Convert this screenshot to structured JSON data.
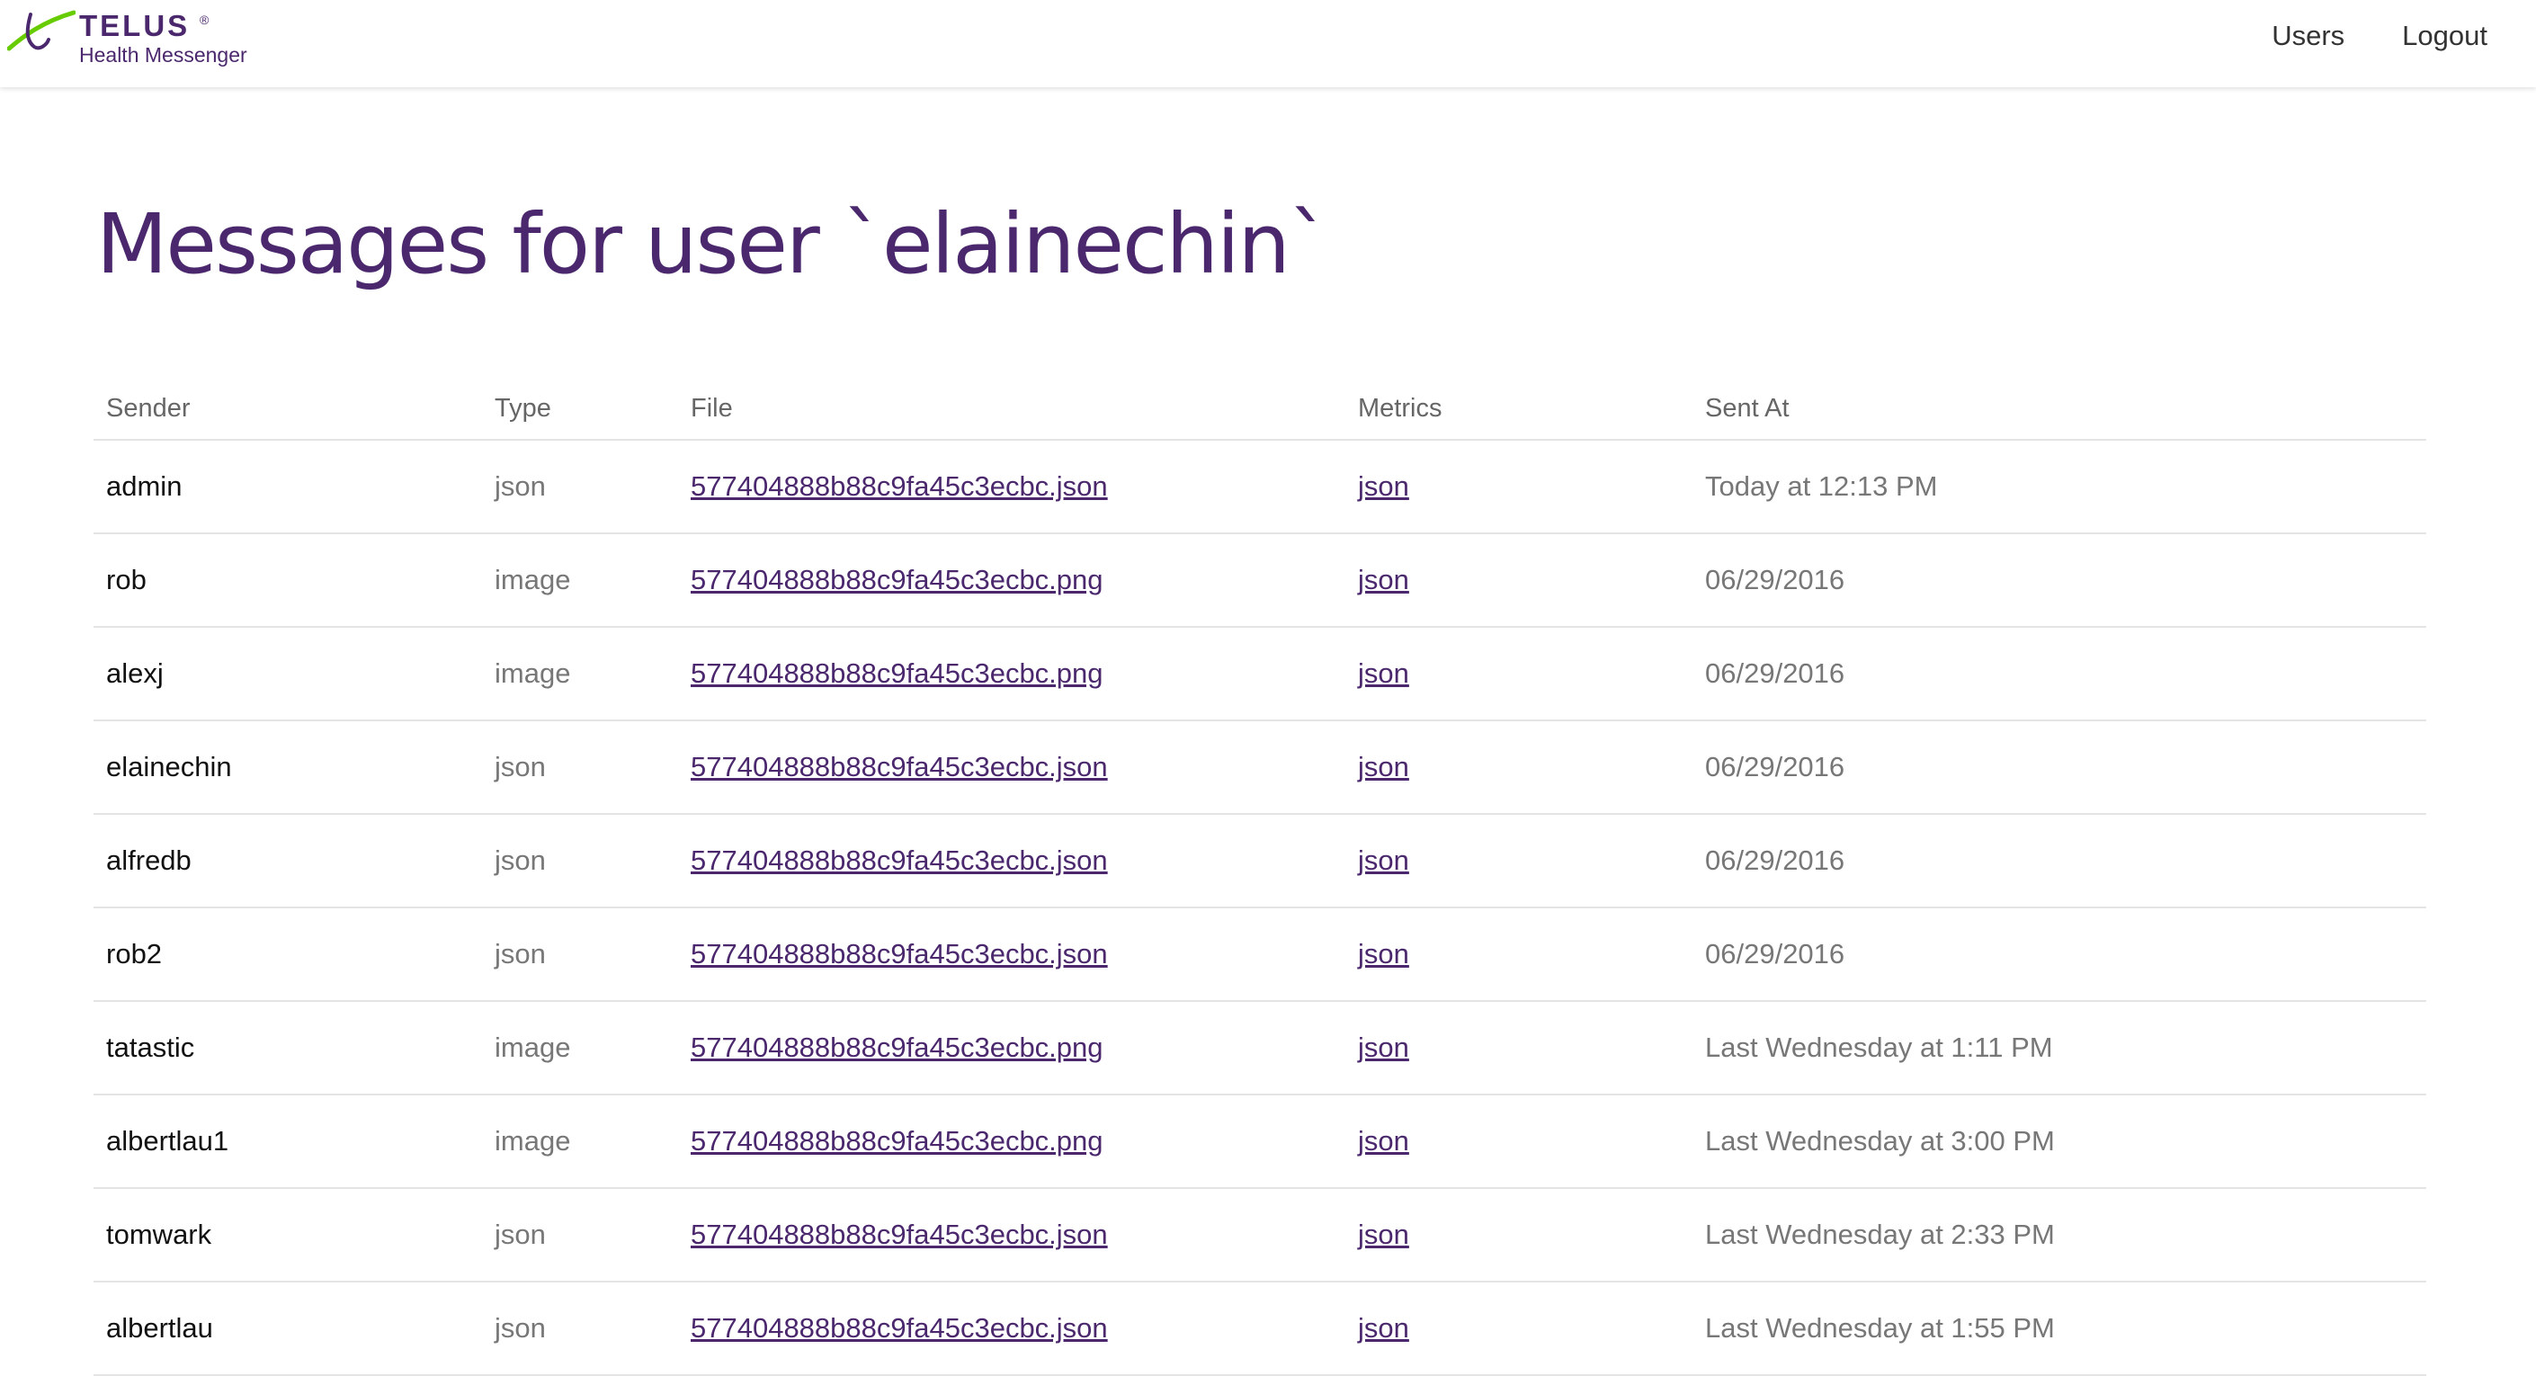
{
  "brand": {
    "name": "TELUS",
    "registered": "®",
    "product": "Health Messenger"
  },
  "nav": {
    "users_label": "Users",
    "logout_label": "Logout"
  },
  "page": {
    "title": "Messages for user `elainechin`"
  },
  "table": {
    "headers": {
      "sender": "Sender",
      "type": "Type",
      "file": "File",
      "metrics": "Metrics",
      "sent_at": "Sent At"
    },
    "rows": [
      {
        "sender": "admin",
        "type": "json",
        "file": "577404888b88c9fa45c3ecbc.json",
        "metrics": "json",
        "sent_at": "Today at 12:13 PM"
      },
      {
        "sender": "rob",
        "type": "image",
        "file": "577404888b88c9fa45c3ecbc.png",
        "metrics": "json",
        "sent_at": "06/29/2016"
      },
      {
        "sender": "alexj",
        "type": "image",
        "file": "577404888b88c9fa45c3ecbc.png",
        "metrics": "json",
        "sent_at": "06/29/2016"
      },
      {
        "sender": "elainechin",
        "type": "json",
        "file": "577404888b88c9fa45c3ecbc.json",
        "metrics": "json",
        "sent_at": "06/29/2016"
      },
      {
        "sender": "alfredb",
        "type": "json",
        "file": "577404888b88c9fa45c3ecbc.json",
        "metrics": "json",
        "sent_at": "06/29/2016"
      },
      {
        "sender": "rob2",
        "type": "json",
        "file": "577404888b88c9fa45c3ecbc.json",
        "metrics": "json",
        "sent_at": "06/29/2016"
      },
      {
        "sender": "tatastic",
        "type": "image",
        "file": "577404888b88c9fa45c3ecbc.png",
        "metrics": "json",
        "sent_at": "Last Wednesday at 1:11 PM"
      },
      {
        "sender": "albertlau1",
        "type": "image",
        "file": "577404888b88c9fa45c3ecbc.png",
        "metrics": "json",
        "sent_at": "Last Wednesday at 3:00 PM"
      },
      {
        "sender": "tomwark",
        "type": "json",
        "file": "577404888b88c9fa45c3ecbc.json",
        "metrics": "json",
        "sent_at": "Last Wednesday at 2:33 PM"
      },
      {
        "sender": "albertlau",
        "type": "json",
        "file": "577404888b88c9fa45c3ecbc.json",
        "metrics": "json",
        "sent_at": "Last Wednesday at 1:55 PM"
      }
    ]
  },
  "colors": {
    "brand_purple": "#4b286d",
    "brand_green": "#66cc00"
  }
}
